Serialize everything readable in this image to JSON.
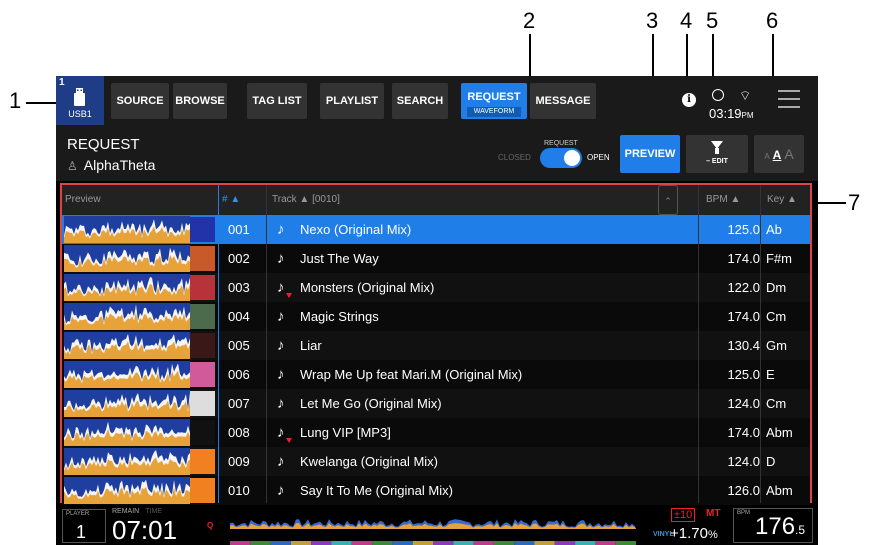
{
  "callouts": [
    "1",
    "2",
    "3",
    "4",
    "5",
    "6",
    "7"
  ],
  "topbar": {
    "usb_number": "1",
    "usb_label": "USB1",
    "buttons": [
      "SOURCE",
      "BROWSE",
      "TAG LIST",
      "PLAYLIST",
      "SEARCH",
      "REQUEST",
      "MESSAGE"
    ],
    "request_sub": "WAVEFORM",
    "clock": "03:19",
    "clock_suffix": "PM"
  },
  "header": {
    "title": "REQUEST",
    "user": "AlphaTheta",
    "request_label": "REQUEST",
    "closed_label": "CLOSED",
    "open_label": "OPEN",
    "preview_label": "PREVIEW",
    "edit_label": "– EDIT",
    "font_small": "A",
    "font_mid": "A",
    "font_big": "A"
  },
  "table": {
    "col_preview": "Preview",
    "col_num": "# ▲",
    "col_track": "Track ▲  [0010]",
    "col_bpm": "BPM ▲",
    "col_key": "Key ▲",
    "rows": [
      {
        "num": "001",
        "title": "Nexo (Original Mix)",
        "bpm": "125.0",
        "key": "Ab",
        "art_color": "#2233aa"
      },
      {
        "num": "002",
        "title": "Just The Way",
        "bpm": "174.0",
        "key": "F#m",
        "art_color": "#c85a2a"
      },
      {
        "num": "003",
        "title": "Monsters (Original Mix)",
        "bpm": "122.0",
        "key": "Dm",
        "art_color": "#b8323a"
      },
      {
        "num": "004",
        "title": "Magic Strings",
        "bpm": "174.0",
        "key": "Cm",
        "art_color": "#4c6a4c"
      },
      {
        "num": "005",
        "title": "Liar",
        "bpm": "130.4",
        "key": "Gm",
        "art_color": "#3a1818"
      },
      {
        "num": "006",
        "title": "Wrap Me Up feat Mari.M (Original Mix)",
        "bpm": "125.0",
        "key": "E",
        "art_color": "#d05a9a"
      },
      {
        "num": "007",
        "title": "Let Me Go (Original Mix)",
        "bpm": "124.0",
        "key": "Cm",
        "art_color": "#ddd"
      },
      {
        "num": "008",
        "title": "Lung VIP [MP3]",
        "bpm": "174.0",
        "key": "Abm",
        "art_color": "#111"
      },
      {
        "num": "009",
        "title": "Kwelanga (Original Mix)",
        "bpm": "124.0",
        "key": "D",
        "art_color": "#f08020"
      },
      {
        "num": "010",
        "title": "Say It To Me (Original Mix)",
        "bpm": "126.0",
        "key": "Abm",
        "art_color": "#f08020"
      }
    ]
  },
  "footer": {
    "player_label": "PLAYER",
    "player_num": "1",
    "remain_label": "REMAIN",
    "time_label": "TIME",
    "time": "07:01",
    "q": "Q",
    "vinyl": "VINYL",
    "pitch_range": "±10",
    "mt": "MT",
    "pitch": "+1.70",
    "pitch_unit": "%",
    "bpm_label": "BPM",
    "bpm_int": "176",
    "bpm_dec": ".5"
  },
  "colors": {
    "accent": "#1f7ee8",
    "highlight_border": "#d44"
  }
}
